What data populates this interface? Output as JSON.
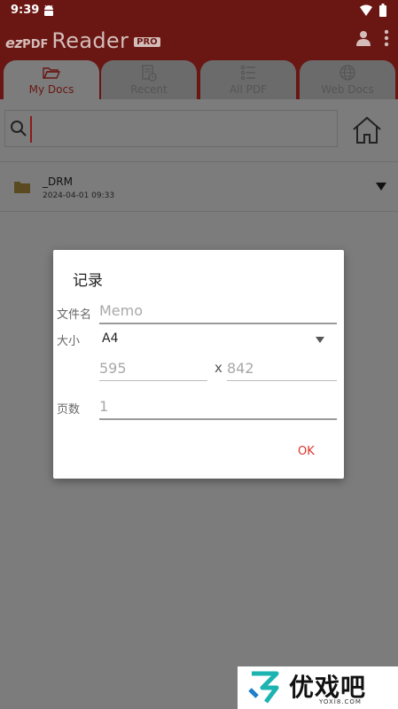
{
  "status_bar": {
    "time": "9:39"
  },
  "app_bar": {
    "logo_ez": "ez",
    "logo_pdf": "PDF",
    "logo_reader": "Reader",
    "logo_badge": "PRO"
  },
  "tabs": [
    {
      "label": "My Docs",
      "icon": "folder-open-icon",
      "active": true
    },
    {
      "label": "Recent",
      "icon": "recent-doc-icon",
      "active": false
    },
    {
      "label": "All PDF",
      "icon": "list-icon",
      "active": false
    },
    {
      "label": "Web Docs",
      "icon": "globe-icon",
      "active": false
    }
  ],
  "search": {
    "value": ""
  },
  "files": [
    {
      "name": "_DRM",
      "date": "2024-04-01 09:33"
    }
  ],
  "dialog": {
    "title": "记录",
    "filename_label": "文件名",
    "filename_placeholder": "Memo",
    "size_label": "大小",
    "size_value": "A4",
    "width_placeholder": "595",
    "times": "x",
    "height_placeholder": "842",
    "pages_label": "页数",
    "pages_placeholder": "1",
    "ok_label": "OK"
  },
  "watermark": {
    "text": "优戏吧",
    "url": "YOXI8.COM"
  },
  "colors": {
    "app_bar": "#6a1713",
    "scrim_background": "#7c7c7c",
    "ok_accent": "#d9352a"
  }
}
